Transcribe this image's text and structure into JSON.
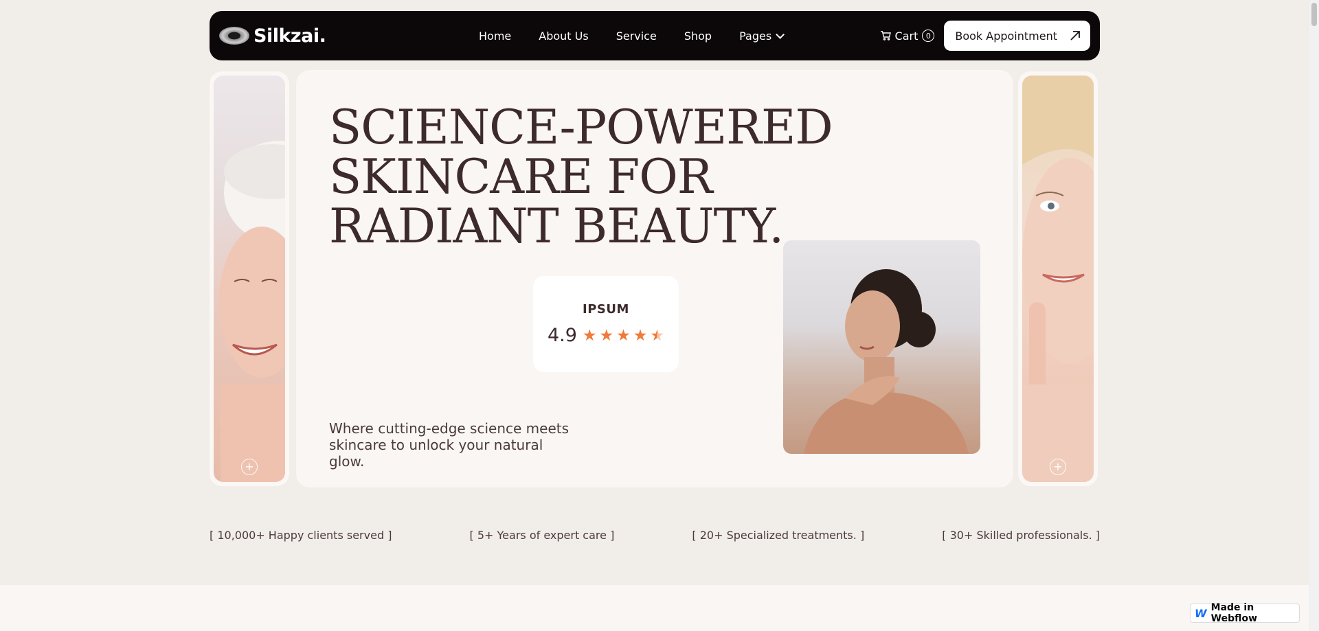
{
  "brand": {
    "name": "Silkzai."
  },
  "nav": {
    "items": [
      {
        "label": "Home"
      },
      {
        "label": "About Us"
      },
      {
        "label": "Service"
      },
      {
        "label": "Shop"
      },
      {
        "label": "Pages"
      }
    ],
    "cart_label": "Cart",
    "cart_count": "0",
    "cta_label": "Book Appointment"
  },
  "hero": {
    "title": "SCIENCE-POWERED SKINCARE FOR RADIANT BEAUTY.",
    "subtitle": "Where cutting-edge science meets skincare to unlock your natural glow.",
    "rating": {
      "brand": "IPSUM",
      "value": "4.9",
      "stars": 4.5
    }
  },
  "stats": [
    {
      "label": "[ 10,000+ Happy clients served ]"
    },
    {
      "label": "[ 5+ Years of expert care ]"
    },
    {
      "label": "[ 20+ Specialized treatments. ]"
    },
    {
      "label": "[ 30+ Skilled professionals. ]"
    }
  ],
  "badge": {
    "label": "Made in Webflow"
  },
  "colors": {
    "accent": "#f07a3a",
    "nav_bg": "#0c0809",
    "text": "#3d2a2d"
  }
}
